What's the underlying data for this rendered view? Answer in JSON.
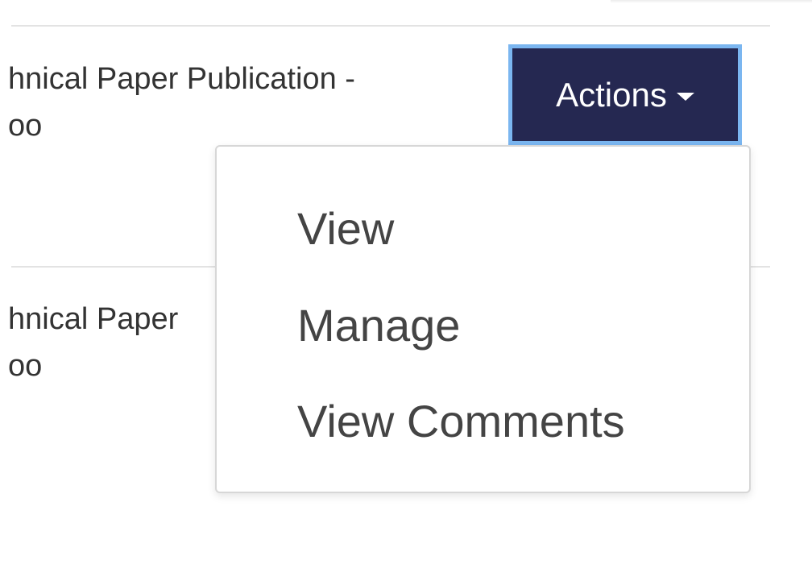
{
  "rows": [
    {
      "title_line1": "hnical Paper Publication -",
      "title_line2": "oo"
    },
    {
      "title_line1": "hnical Paper",
      "title_line2": "oo"
    }
  ],
  "actions_button": {
    "label": "Actions",
    "icon": "caret-down-icon"
  },
  "dropdown": {
    "items": [
      {
        "label": "View"
      },
      {
        "label": "Manage"
      },
      {
        "label": "View Comments"
      }
    ]
  },
  "colors": {
    "button_bg": "#252851",
    "button_focus_ring": "#7bb6f0",
    "divider": "#e3e3e3",
    "text": "#333333"
  }
}
